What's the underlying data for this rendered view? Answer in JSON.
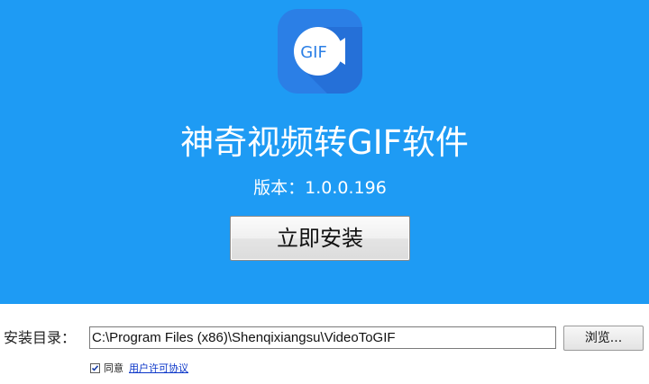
{
  "header": {
    "logo_text": "GIF",
    "app_title": "神奇视频转GIF软件",
    "version_text": "版本：1.0.0.196",
    "install_button_label": "立即安装"
  },
  "install": {
    "dir_label": "安装目录：",
    "dir_value": "C:\\Program Files (x86)\\Shenqixiangsu\\VideoToGIF",
    "browse_label": "浏览..."
  },
  "agreement": {
    "checked": true,
    "agree_text": "同意",
    "license_link_text": "用户许可协议"
  },
  "colors": {
    "hero_background": "#1e9bf4",
    "logo_background": "#2b7fe6",
    "link": "#0a35c8"
  },
  "icons": {
    "logo": "video-gif-icon",
    "checkbox": "checkmark-icon"
  }
}
